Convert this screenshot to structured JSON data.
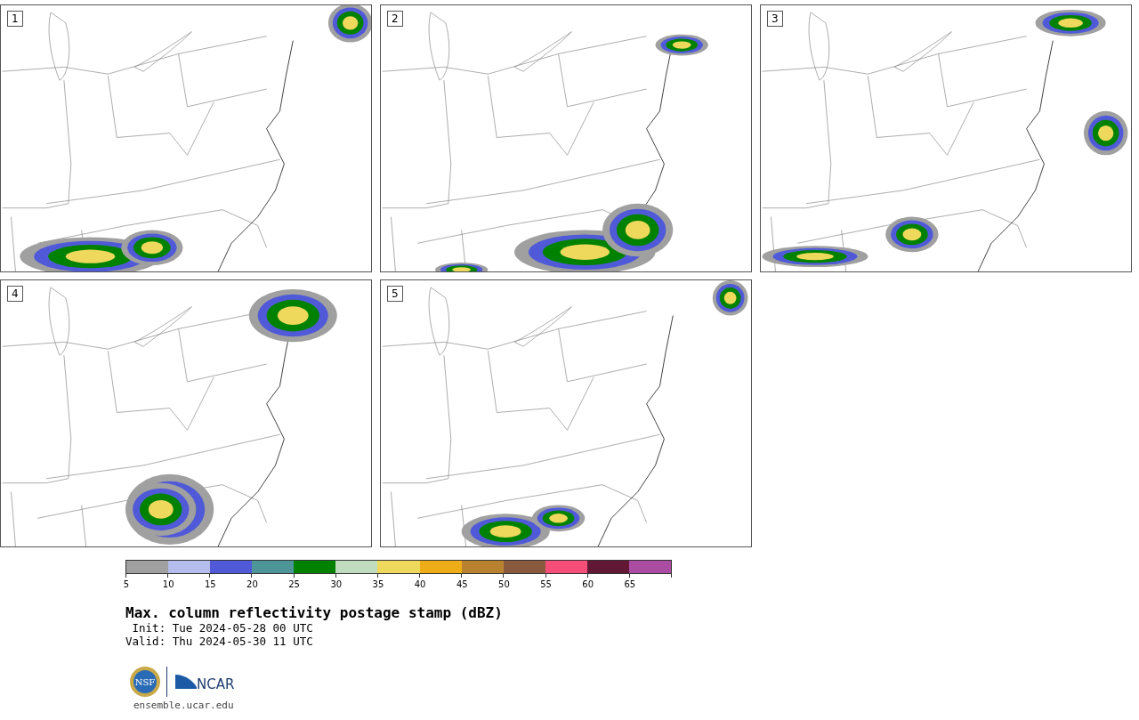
{
  "panels": [
    {
      "label": "1"
    },
    {
      "label": "2"
    },
    {
      "label": "3"
    },
    {
      "label": "4"
    },
    {
      "label": "5"
    }
  ],
  "colorbar": {
    "segments": [
      {
        "color": "#a0a0a0"
      },
      {
        "color": "#b4bdec"
      },
      {
        "color": "#505ad8"
      },
      {
        "color": "#4d9599"
      },
      {
        "color": "#008200"
      },
      {
        "color": "#bfdcbe"
      },
      {
        "color": "#eed95c"
      },
      {
        "color": "#eead16"
      },
      {
        "color": "#b98230"
      },
      {
        "color": "#8a5a3e"
      },
      {
        "color": "#f54f79"
      },
      {
        "color": "#621834"
      },
      {
        "color": "#ab4ca3"
      }
    ],
    "ticks": [
      "5",
      "10",
      "15",
      "20",
      "25",
      "30",
      "35",
      "40",
      "45",
      "50",
      "55",
      "60",
      "65"
    ]
  },
  "title": "Max. column reflectivity postage stamp (dBZ)",
  "init": " Init: Tue 2024-05-28 00 UTC",
  "valid": "Valid: Thu 2024-05-30 11 UTC",
  "logos": {
    "nsf": "NSF",
    "ncar": "NCAR"
  },
  "url": "ensemble.ucar.edu"
}
